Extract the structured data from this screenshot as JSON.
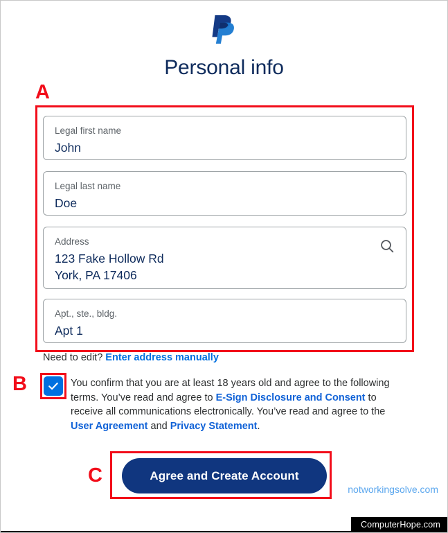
{
  "brand": {
    "logo_name": "paypal-logo",
    "logo_dark": "#143a85",
    "logo_light": "#1878d0"
  },
  "header": {
    "title": "Personal info"
  },
  "form": {
    "fields": [
      {
        "name": "legal-first-name",
        "label": "Legal first name",
        "value": "John"
      },
      {
        "name": "legal-last-name",
        "label": "Legal last name",
        "value": "Doe"
      },
      {
        "name": "address",
        "label": "Address",
        "value": "123 Fake Hollow Rd",
        "value2": "York, PA 17406",
        "icon": "search-icon"
      },
      {
        "name": "apartment",
        "label": "Apt., ste., bldg.",
        "value": "Apt 1"
      }
    ],
    "need_to_edit": {
      "prefix": "Need to edit? ",
      "link": "Enter address manually"
    }
  },
  "consent": {
    "checked": true,
    "checkmark": "✓",
    "part1": "You confirm that you are at least 18 years old and agree to the following terms. You’ve read and agree to ",
    "link1": "E-Sign Disclosure and Consent",
    "part2": " to receive all communications electronically. You’ve read and agree to the ",
    "link2": "User Agreement",
    "part3": " and ",
    "link3": "Privacy Statement",
    "part4": "."
  },
  "cta": {
    "label": "Agree and Create Account",
    "background": "#10367f"
  },
  "annotations": {
    "a": "A",
    "b": "B",
    "c": "C",
    "color": "#f20d1a"
  },
  "watermark": {
    "text": "notworkingsolve.com",
    "color": "#5ba7ee"
  },
  "footer": {
    "text": "ComputerHope.com"
  }
}
